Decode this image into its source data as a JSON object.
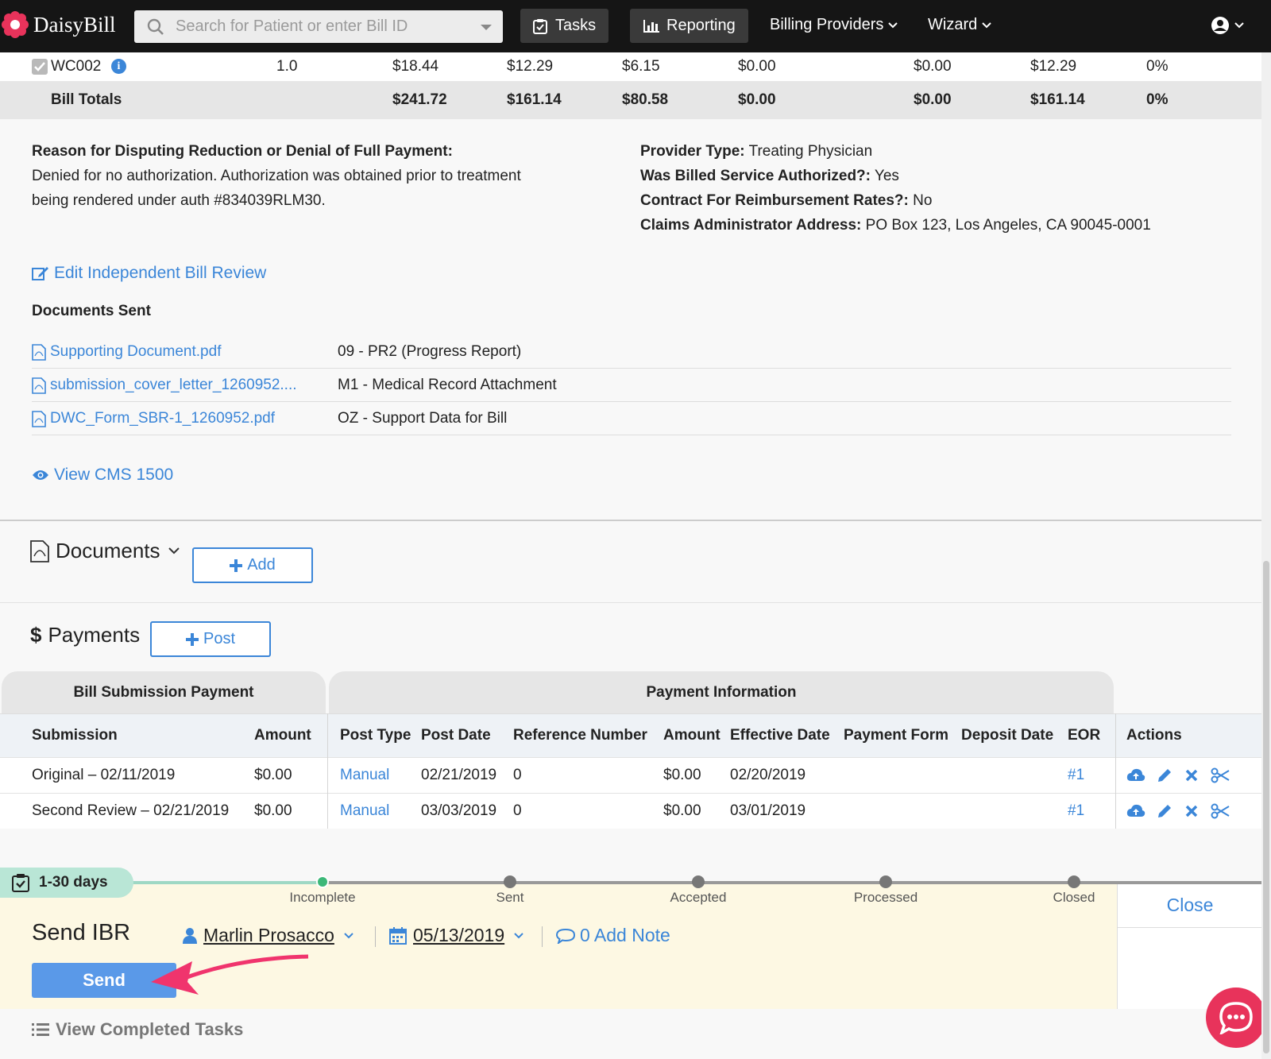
{
  "nav": {
    "brand": "DaisyBill",
    "search_placeholder": "Search for Patient or enter Bill ID",
    "tasks": "Tasks",
    "reporting": "Reporting",
    "billing_providers": "Billing Providers",
    "wizard": "Wizard"
  },
  "bill_lines": {
    "wc_row": {
      "code": "WC002",
      "units": "1.0",
      "c1": "$18.44",
      "c2": "$12.29",
      "c3": "$6.15",
      "c4": "$0.00",
      "c5": "$0.00",
      "c6": "$12.29",
      "c7": "0%"
    },
    "totals": {
      "label": "Bill Totals",
      "c1": "$241.72",
      "c2": "$161.14",
      "c3": "$80.58",
      "c4": "$0.00",
      "c5": "$0.00",
      "c6": "$161.14",
      "c7": "0%"
    }
  },
  "ibr": {
    "reason_label": "Reason for Disputing Reduction or Denial of Full Payment:",
    "reason_line1": "Denied for no authorization. Authorization was obtained prior to treatment",
    "reason_line2": "being rendered under auth #834039RLM30.",
    "provider_type_label": "Provider Type:",
    "provider_type": "Treating Physician",
    "authorized_label": "Was Billed Service Authorized?:",
    "authorized": "Yes",
    "contract_label": "Contract For Reimbursement Rates?:",
    "contract": "No",
    "claims_addr_label": "Claims Administrator Address:",
    "claims_addr": "PO Box 123, Los Angeles, CA 90045-0001",
    "edit_link": "Edit Independent Bill Review",
    "docs_sent_title": "Documents Sent",
    "documents": [
      {
        "file": "Supporting Document.pdf",
        "type": "09 - PR2 (Progress Report)"
      },
      {
        "file": "submission_cover_letter_1260952....",
        "type": "M1 - Medical Record Attachment"
      },
      {
        "file": "DWC_Form_SBR-1_1260952.pdf",
        "type": "OZ - Support Data for Bill"
      }
    ],
    "view_cms": "View CMS 1500"
  },
  "documents_section": {
    "title": "Documents",
    "add": "Add"
  },
  "payments": {
    "title": "Payments",
    "dollar": "$",
    "post": "Post",
    "group_submission": "Bill Submission Payment",
    "group_info": "Payment Information",
    "headers": {
      "submission": "Submission",
      "amount": "Amount",
      "post_type": "Post Type",
      "post_date": "Post Date",
      "ref": "Reference Number",
      "amount2": "Amount",
      "eff": "Effective Date",
      "form": "Payment Form",
      "deposit": "Deposit Date",
      "eor": "EOR",
      "actions": "Actions"
    },
    "rows": [
      {
        "submission": "Original – 02/11/2019",
        "amount": "$0.00",
        "post_type": "Manual",
        "post_date": "02/21/2019",
        "ref": "0",
        "amount2": "$0.00",
        "eff": "02/20/2019",
        "eor": "#1"
      },
      {
        "submission": "Second Review – 02/21/2019",
        "amount": "$0.00",
        "post_type": "Manual",
        "post_date": "03/03/2019",
        "ref": "0",
        "amount2": "$0.00",
        "eff": "03/01/2019",
        "eor": "#1"
      }
    ]
  },
  "task": {
    "badge": "1-30 days",
    "steps": [
      "Incomplete",
      "Sent",
      "Accepted",
      "Processed",
      "Closed"
    ],
    "close": "Close",
    "title": "Send IBR",
    "assignee": "Marlin Prosacco",
    "date": "05/13/2019",
    "note": "0 Add Note",
    "send": "Send"
  },
  "completed": "View Completed Tasks",
  "colors": {
    "accent": "#3b86d8",
    "nav_bg": "#151515",
    "task_bg": "#fdf8e3",
    "badge": "#b9e6d6",
    "arrow": "#f0346d",
    "chat": "#e8335b"
  }
}
